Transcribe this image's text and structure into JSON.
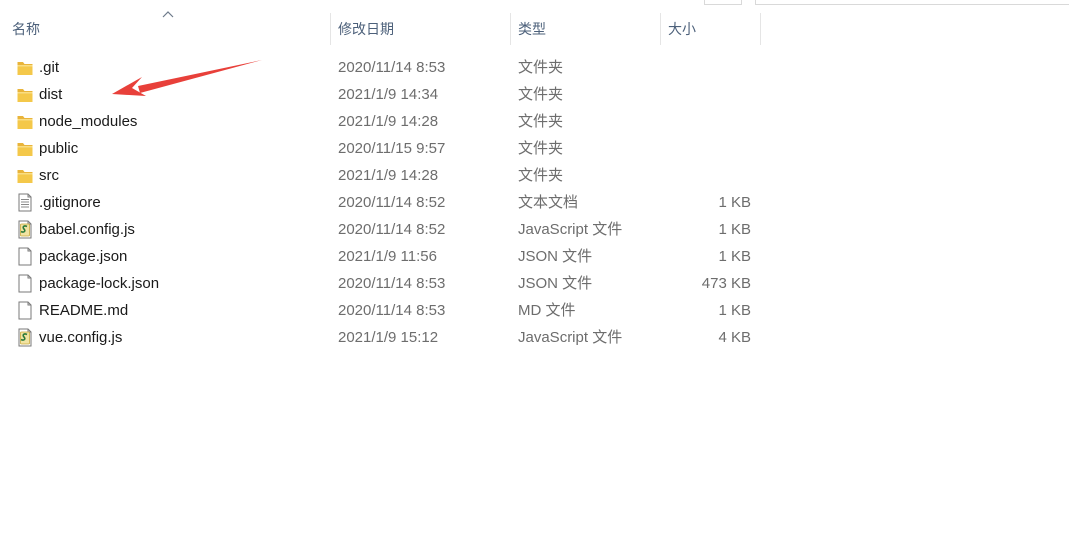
{
  "columns": {
    "name": "名称",
    "date": "修改日期",
    "type": "类型",
    "size": "大小"
  },
  "colors": {
    "folder": "#f4c84a",
    "header_text": "#4c607a",
    "arrow": "#e8403a"
  },
  "files": [
    {
      "name": ".git",
      "date": "2020/11/14 8:53",
      "type": "文件夹",
      "size": "",
      "icon": "folder-icon"
    },
    {
      "name": "dist",
      "date": "2021/1/9 14:34",
      "type": "文件夹",
      "size": "",
      "icon": "folder-icon"
    },
    {
      "name": "node_modules",
      "date": "2021/1/9 14:28",
      "type": "文件夹",
      "size": "",
      "icon": "folder-icon"
    },
    {
      "name": "public",
      "date": "2020/11/15 9:57",
      "type": "文件夹",
      "size": "",
      "icon": "folder-icon"
    },
    {
      "name": "src",
      "date": "2021/1/9 14:28",
      "type": "文件夹",
      "size": "",
      "icon": "folder-icon"
    },
    {
      "name": ".gitignore",
      "date": "2020/11/14 8:52",
      "type": "文本文档",
      "size": "1 KB",
      "icon": "text-file-icon"
    },
    {
      "name": "babel.config.js",
      "date": "2020/11/14 8:52",
      "type": "JavaScript 文件",
      "size": "1 KB",
      "icon": "script-file-icon"
    },
    {
      "name": "package.json",
      "date": "2021/1/9 11:56",
      "type": "JSON 文件",
      "size": "1 KB",
      "icon": "blank-file-icon"
    },
    {
      "name": "package-lock.json",
      "date": "2020/11/14 8:53",
      "type": "JSON 文件",
      "size": "473 KB",
      "icon": "blank-file-icon"
    },
    {
      "name": "README.md",
      "date": "2020/11/14 8:53",
      "type": "MD 文件",
      "size": "1 KB",
      "icon": "blank-file-icon"
    },
    {
      "name": "vue.config.js",
      "date": "2021/1/9 15:12",
      "type": "JavaScript 文件",
      "size": "4 KB",
      "icon": "script-file-icon"
    }
  ]
}
